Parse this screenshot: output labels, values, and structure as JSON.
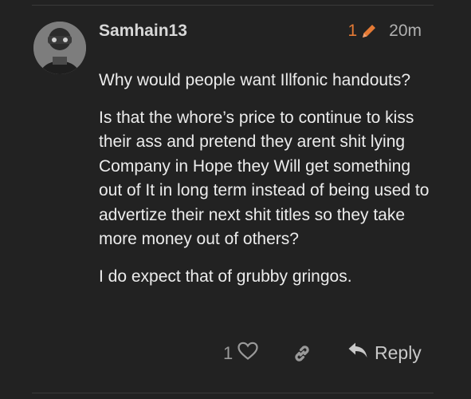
{
  "post": {
    "username": "Samhain13",
    "edit_count": "1",
    "age": "20m",
    "paragraphs": [
      "Why would people want Illfonic handouts?",
      "Is that the whore’s price to continue to kiss their ass and pretend they arent shit lying Company in Hope they Will get something out of It in long term instead of being used to advertize their next shit titles so they take more money out of others?",
      "I do expect that of grubby gringos."
    ],
    "likes": "1",
    "reply_label": "Reply"
  },
  "colors": {
    "background": "#222222",
    "edit_accent": "#e57a35"
  },
  "icons": {
    "edit": "pencil-icon",
    "like": "heart-icon",
    "share": "link-icon",
    "reply": "reply-arrow-icon"
  }
}
